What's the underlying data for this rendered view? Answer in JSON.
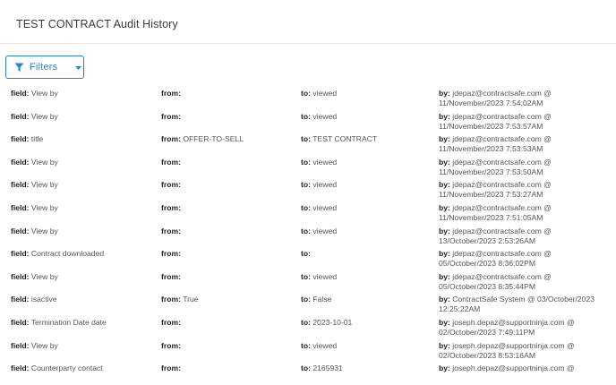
{
  "header": {
    "title": "TEST CONTRACT Audit History"
  },
  "toolbar": {
    "filters_label": "Filters"
  },
  "labels": {
    "field": "field:",
    "from": "from:",
    "to": "to:",
    "by": "by:"
  },
  "rows": [
    {
      "field": "View by",
      "from": "",
      "to": "viewed",
      "by": "jdepaz@contractsafe.com @",
      "when": "11/November/2023 7:54:02AM"
    },
    {
      "field": "View by",
      "from": "",
      "to": "viewed",
      "by": "jdepaz@contractsafe.com @",
      "when": "11/November/2023 7:53:57AM"
    },
    {
      "field": "title",
      "from": "OFFER-TO-SELL",
      "to": "TEST CONTRACT",
      "by": "jdepaz@contractsafe.com @",
      "when": "11/November/2023 7:53:53AM"
    },
    {
      "field": "View by",
      "from": "",
      "to": "viewed",
      "by": "jdepaz@contractsafe.com @",
      "when": "11/November/2023 7:53:50AM"
    },
    {
      "field": "View by",
      "from": "",
      "to": "viewed",
      "by": "jdepaz@contractsafe.com @",
      "when": "11/November/2023 7:53:27AM"
    },
    {
      "field": "View by",
      "from": "",
      "to": "viewed",
      "by": "jdepaz@contractsafe.com @",
      "when": "11/November/2023 7:51:05AM"
    },
    {
      "field": "View by",
      "from": "",
      "to": "viewed",
      "by": "jdepaz@contractsafe.com @",
      "when": "13/October/2023 2:53:26AM"
    },
    {
      "field": "Contract downloaded",
      "from": "",
      "to": "",
      "by": "jdepaz@contractsafe.com @",
      "when": "05/October/2023 8:36:02PM"
    },
    {
      "field": "View by",
      "from": "",
      "to": "viewed",
      "by": "jdepaz@contractsafe.com @",
      "when": "05/October/2023 8:35:44PM"
    },
    {
      "field": "isactive",
      "from": "True",
      "to": "False",
      "by": "ContractSafe System @ 03/October/2023",
      "when": "12:25:22AM"
    },
    {
      "field": "Termination Date date",
      "from": "",
      "to": "2023-10-01",
      "by": "joseph.depaz@supportninja.com @",
      "when": "02/October/2023 7:49:11PM"
    },
    {
      "field": "View by",
      "from": "",
      "to": "viewed",
      "by": "joseph.depaz@supportninja.com @",
      "when": "02/October/2023 8:53:16AM"
    },
    {
      "field": "Counterparty contact",
      "from": "",
      "to": "2165931",
      "by": "joseph.depaz@supportninja.com @",
      "when": ""
    }
  ],
  "colors": {
    "accent": "#2b82c9",
    "divider": "#e6e6e6"
  },
  "icons": {
    "filter": "filter-funnel-icon",
    "dropdown": "caret-down-icon"
  }
}
